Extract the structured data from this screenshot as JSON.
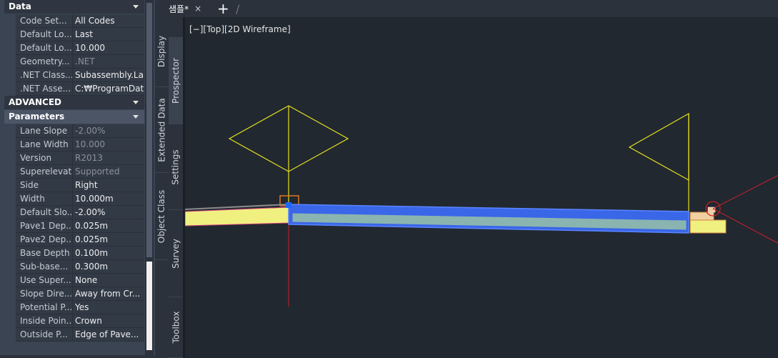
{
  "palette": {
    "section_data": "Data",
    "data_rows": [
      {
        "key": "Code Set...",
        "value": "All Codes",
        "dim": false
      },
      {
        "key": "Default Lo...",
        "value": "Last",
        "dim": false
      },
      {
        "key": "Default Lo...",
        "value": "10.000",
        "dim": false
      },
      {
        "key": "Geometry...",
        "value": ".NET",
        "dim": true
      },
      {
        "key": ".NET Class...",
        "value": "Subassembly.La...",
        "dim": false
      },
      {
        "key": ".NET Asse...",
        "value": "C:₩ProgramDat...",
        "dim": false
      }
    ],
    "section_advanced": "ADVANCED",
    "section_parameters": "Parameters",
    "param_rows": [
      {
        "key": "Lane Slope",
        "value": "-2.00%",
        "dim": true
      },
      {
        "key": "Lane Width",
        "value": "10.000",
        "dim": true
      },
      {
        "key": "Version",
        "value": "R2013",
        "dim": true
      },
      {
        "key": "Superelevati...",
        "value": "Supported",
        "dim": true
      },
      {
        "key": "Side",
        "value": "Right",
        "dim": false
      },
      {
        "key": "Width",
        "value": "10.000m",
        "dim": false
      },
      {
        "key": "Default Slo...",
        "value": "-2.00%",
        "dim": false
      },
      {
        "key": "Pave1 Dep...",
        "value": "0.025m",
        "dim": false
      },
      {
        "key": "Pave2 Dep...",
        "value": "0.025m",
        "dim": false
      },
      {
        "key": "Base Depth",
        "value": "0.100m",
        "dim": false
      },
      {
        "key": "Sub-base...",
        "value": "0.300m",
        "dim": false
      },
      {
        "key": "Use Super...",
        "value": "None",
        "dim": false
      },
      {
        "key": "Slope Dire...",
        "value": "Away from Cr...",
        "dim": false
      },
      {
        "key": "Potential P...",
        "value": "Yes",
        "dim": false
      },
      {
        "key": "Inside Poin...",
        "value": "Crown",
        "dim": false
      },
      {
        "key": "Outside P...",
        "value": "Edge of Pave...",
        "dim": false
      }
    ]
  },
  "side_tabs_outer": [
    "Display",
    "Extended Data",
    "Object Class"
  ],
  "side_tabs_inner": [
    "Prospector",
    "Settings",
    "Survey",
    "Toolbox"
  ],
  "document_tab": {
    "label": "샘플*",
    "close": "×"
  },
  "new_tab": "+",
  "viewport": {
    "label": "[−][Top][2D Wireframe]"
  },
  "colors": {
    "yellow_lines": "#e8e020",
    "red_axis": "#c8202a",
    "lane_blue": "#3a66e8",
    "lane_fill": "#8ab4b0",
    "shoulder_fill": "#f0f080"
  }
}
